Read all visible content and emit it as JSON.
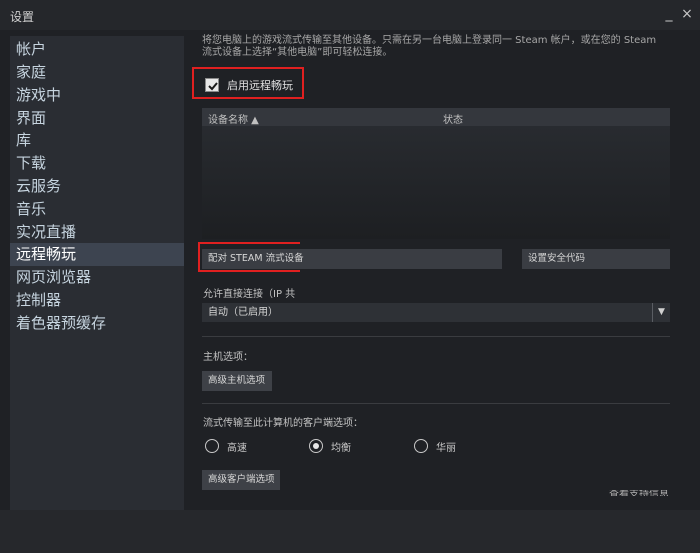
{
  "window": {
    "title": "设置",
    "minimize_icon": "_",
    "close_icon": "×"
  },
  "sidebar": {
    "items": [
      {
        "label": "帐户",
        "active": false
      },
      {
        "label": "家庭",
        "active": false
      },
      {
        "label": "游戏中",
        "active": false
      },
      {
        "label": "界面",
        "active": false
      },
      {
        "label": "库",
        "active": false
      },
      {
        "label": "下载",
        "active": false
      },
      {
        "label": "云服务",
        "active": false
      },
      {
        "label": "音乐",
        "active": false
      },
      {
        "label": "实况直播",
        "active": false
      },
      {
        "label": "远程畅玩",
        "active": true
      },
      {
        "label": "网页浏览器",
        "active": false
      },
      {
        "label": "控制器",
        "active": false
      },
      {
        "label": "着色器预缓存",
        "active": false
      }
    ]
  },
  "remote_play": {
    "description_line1": "将您电脑上的游戏流式传输至其他设备。只需在另一台电脑上登录同一 Steam 帐户，或在您的 Steam",
    "description_line2": "流式设备上选择“其他电脑”即可轻松连接。",
    "enable_checkbox_label": "启用远程畅玩",
    "enable_checked": true,
    "table": {
      "col_device": "设备名称 ▲",
      "col_status": "状态"
    },
    "pair_button": "配对 STEAM 流式设备",
    "security_code_button": "设置安全代码",
    "direct_connect_label": "允许直接连接（IP 共",
    "direct_connect_value": "自动（已启用）",
    "host_options_label": "主机选项：",
    "advanced_host_button": "高级主机选项",
    "client_options_label": "流式传输至此计算机的客户端选项：",
    "quality_options": [
      {
        "label": "高速",
        "checked": false
      },
      {
        "label": "均衡",
        "checked": true
      },
      {
        "label": "华丽",
        "checked": false
      }
    ],
    "advanced_client_button": "高级客户端选项",
    "support_link_partial": "查看支持信息"
  },
  "colors": {
    "highlight_border": "#e02020",
    "active_sidebar": "#3d4450"
  }
}
